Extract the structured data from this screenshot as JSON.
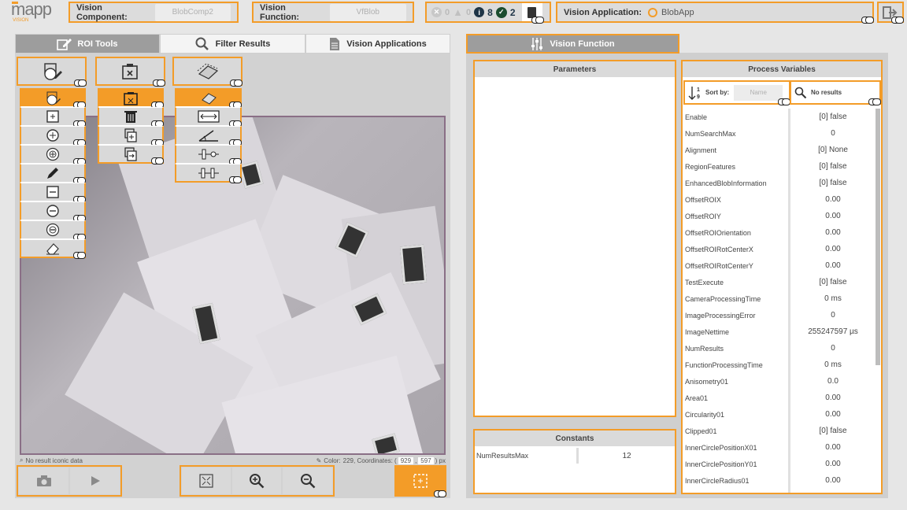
{
  "header": {
    "logo": "mapp",
    "logo_sub": "VISION",
    "vision_component_label": "Vision Component:",
    "vision_component_value": "BlobComp2",
    "vision_function_label": "Vision Function:",
    "vision_function_value": "VfBlob",
    "status_errors": "0",
    "status_warnings": "0",
    "status_info": "8",
    "status_success": "2",
    "vision_application_label": "Vision Application:",
    "vision_application_value": "BlobApp"
  },
  "left_tabs": [
    {
      "label": "ROI Tools",
      "active": true
    },
    {
      "label": "Filter Results",
      "active": false
    },
    {
      "label": "Vision Applications",
      "active": false
    }
  ],
  "right_tab": {
    "label": "Vision Function"
  },
  "roi_tools": {
    "groups": [
      "roi-shapes-icon",
      "delete-copy-icon",
      "transform-icon"
    ],
    "shape_items": [
      "add-roi-icon",
      "rect-icon",
      "circle-icon",
      "circle-ring-icon",
      "pencil-icon",
      "rect-minus-icon",
      "circle-minus-icon",
      "ring-minus-icon",
      "eraser-icon"
    ],
    "edit_items": [
      "clipboard-icon",
      "trash-icon",
      "copy-add-icon",
      "copy-move-icon"
    ],
    "transform_items": [
      "transform-icon",
      "resize-icon",
      "rotate-icon",
      "slider-icon",
      "slider-alt-icon"
    ]
  },
  "image_info": {
    "no_result": "No result iconic data",
    "color_label": "Color:",
    "color_value": "229",
    "coordinates_label": "Coordinates: (",
    "coord_x": "929",
    "coord_y": "597",
    "coord_unit": ") px"
  },
  "parameters": {
    "title": "Parameters"
  },
  "constants": {
    "title": "Constants",
    "rows": [
      {
        "name": "NumResultsMax",
        "value": "12"
      }
    ]
  },
  "process_variables": {
    "title": "Process Variables",
    "sort_label": "Sort by:",
    "sort_value": "Name",
    "search_text": "No results",
    "rows": [
      {
        "name": "Enable",
        "value": "[0] false"
      },
      {
        "name": "NumSearchMax",
        "value": "0"
      },
      {
        "name": "Alignment",
        "value": "[0] None"
      },
      {
        "name": "RegionFeatures",
        "value": "[0] false"
      },
      {
        "name": "EnhancedBlobInformation",
        "value": "[0] false"
      },
      {
        "name": "OffsetROIX",
        "value": "0.00"
      },
      {
        "name": "OffsetROIY",
        "value": "0.00"
      },
      {
        "name": "OffsetROIOrientation",
        "value": "0.00"
      },
      {
        "name": "OffsetROIRotCenterX",
        "value": "0.00"
      },
      {
        "name": "OffsetROIRotCenterY",
        "value": "0.00"
      },
      {
        "name": "TestExecute",
        "value": "[0] false"
      },
      {
        "name": "CameraProcessingTime",
        "value": "0 ms"
      },
      {
        "name": "ImageProcessingError",
        "value": "0"
      },
      {
        "name": "ImageNettime",
        "value": "255247597 µs"
      },
      {
        "name": "NumResults",
        "value": "0"
      },
      {
        "name": "FunctionProcessingTime",
        "value": "0 ms"
      },
      {
        "name": "Anisometry01",
        "value": "0.0"
      },
      {
        "name": "Area01",
        "value": "0.00"
      },
      {
        "name": "Circularity01",
        "value": "0.00"
      },
      {
        "name": "Clipped01",
        "value": "[0] false"
      },
      {
        "name": "InnerCirclePositionX01",
        "value": "0.00"
      },
      {
        "name": "InnerCirclePositionY01",
        "value": "0.00"
      },
      {
        "name": "InnerCircleRadius01",
        "value": "0.00"
      }
    ]
  },
  "colors": {
    "accent": "#f39c28",
    "image_border": "#8a6f86"
  }
}
